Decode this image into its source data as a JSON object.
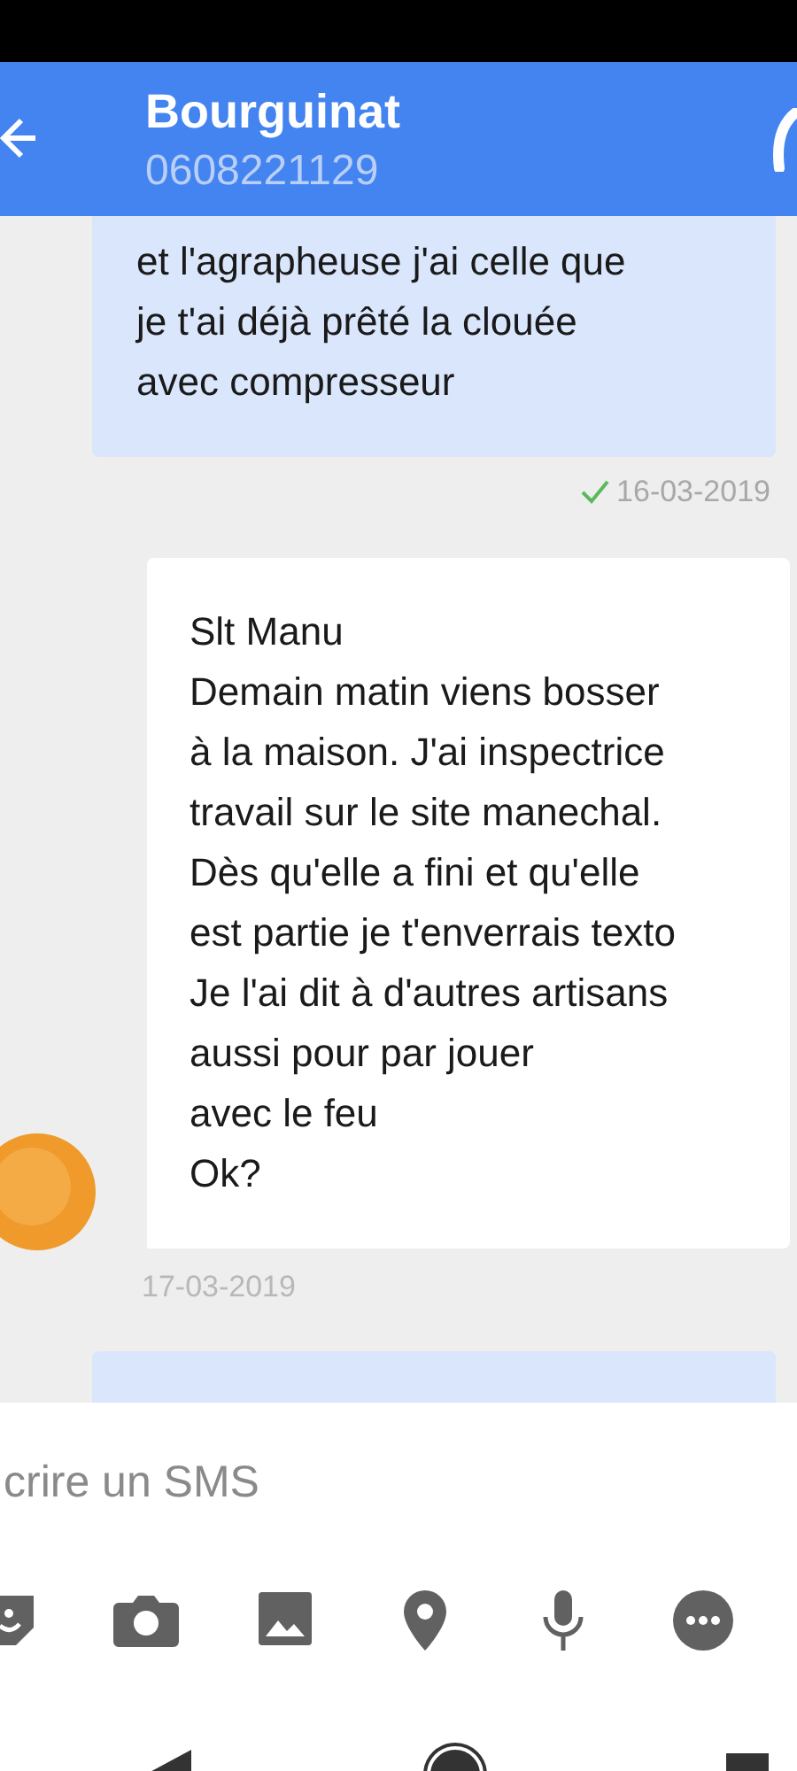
{
  "header": {
    "title": "Bourguinat",
    "subtitle": "0608221129"
  },
  "messages": [
    {
      "kind": "sent",
      "text": "et l'agrapheuse j'ai celle que\nje t'ai déjà prêté la clouée\navec compresseur",
      "time": "16-03-2019",
      "delivered": true
    },
    {
      "kind": "received",
      "text": "Slt Manu\nDemain matin viens bosser\nà la maison. J'ai inspectrice\ntravail sur le site manechal.\nDès qu'elle a fini et qu'elle\nest partie je t'enverrais texto\nJe l'ai dit à d'autres artisans\naussi pour par jouer\navec le feu\nOk?",
      "time": "17-03-2019"
    },
    {
      "kind": "sent"
    }
  ],
  "composer": {
    "placeholder": "crire un SMS"
  }
}
